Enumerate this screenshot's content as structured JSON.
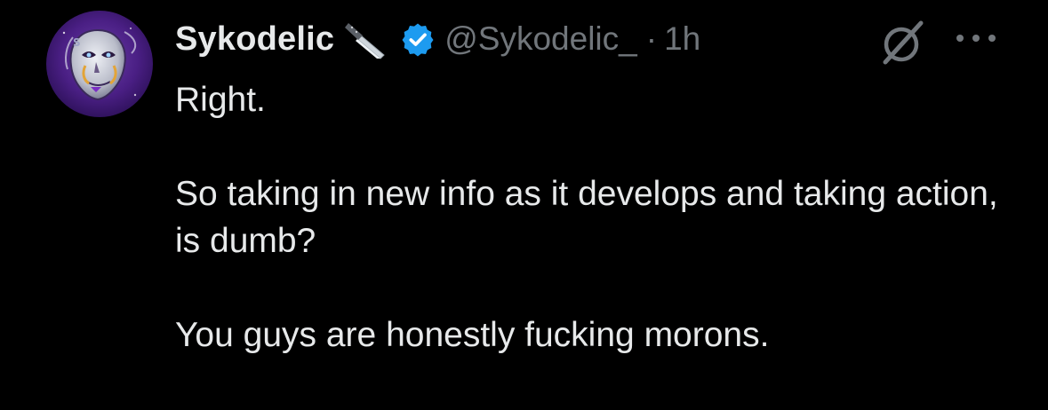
{
  "author": {
    "display_name": "Sykodelic",
    "handle": "@Sykodelic_",
    "dot_separator": "·",
    "timestamp": "1h",
    "name_emoji": "kitchen-knife-emoji",
    "verified": true
  },
  "icons": {
    "avatar": "avatar-mask-image",
    "verified": "verified-badge-icon",
    "grok": "grok-icon",
    "more": "more-options-icon"
  },
  "colors": {
    "background": "#000000",
    "text_primary": "#e7e9ea",
    "text_secondary": "#71767b",
    "verified_blue": "#1d9bf0"
  },
  "tweet": {
    "paragraphs": [
      "Right.",
      "So taking in new info as it develops and taking action, is dumb?",
      "You guys are honestly fucking morons."
    ]
  }
}
